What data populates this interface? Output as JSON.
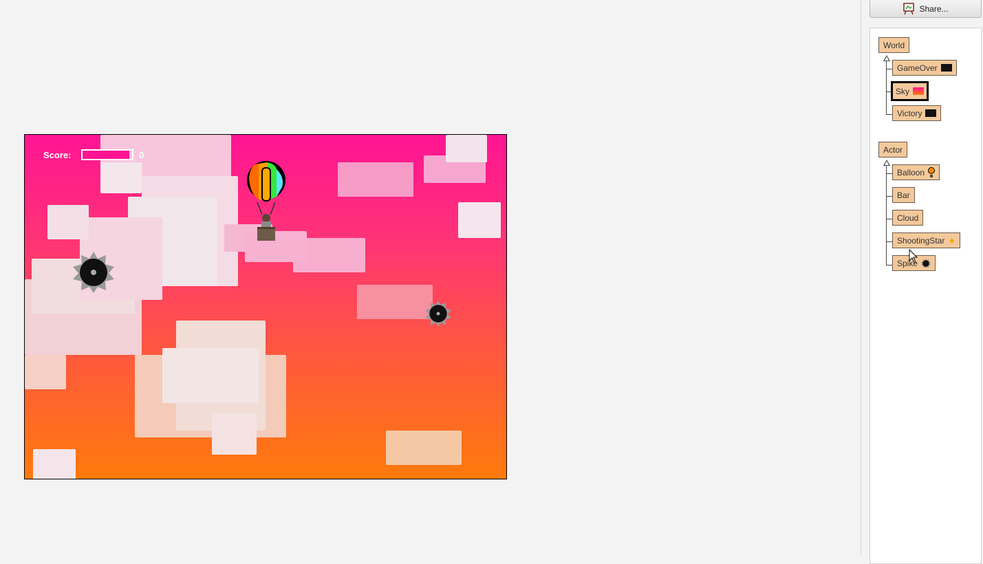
{
  "toolbar": {
    "share_label": "Share..."
  },
  "world": {
    "score_label": "Score:",
    "score_value": "0",
    "score_progress": 0.95,
    "colors": {
      "sky_top": "#ff1493",
      "sky_bottom": "#ff7a0c",
      "bar_fill": "#ff1493"
    }
  },
  "classes": {
    "world_root": "World",
    "world_subclasses": [
      "GameOver",
      "Sky",
      "Victory"
    ],
    "actor_root": "Actor",
    "actor_subclasses": [
      "Balloon",
      "Bar",
      "Cloud",
      "ShootingStar",
      "Spike"
    ],
    "selected": "Sky"
  },
  "icons": {
    "share": "easel-icon",
    "gameover": "black-screen-icon",
    "sky": "gradient-icon",
    "victory": "black-screen-icon",
    "balloon": "balloon-icon",
    "shootingstar": "star-icon",
    "spike": "spike-ball-icon"
  },
  "colors": {
    "class_box": "#f3c99b",
    "panel_bg": "#ffffff",
    "page_bg": "#f3f3f3"
  }
}
